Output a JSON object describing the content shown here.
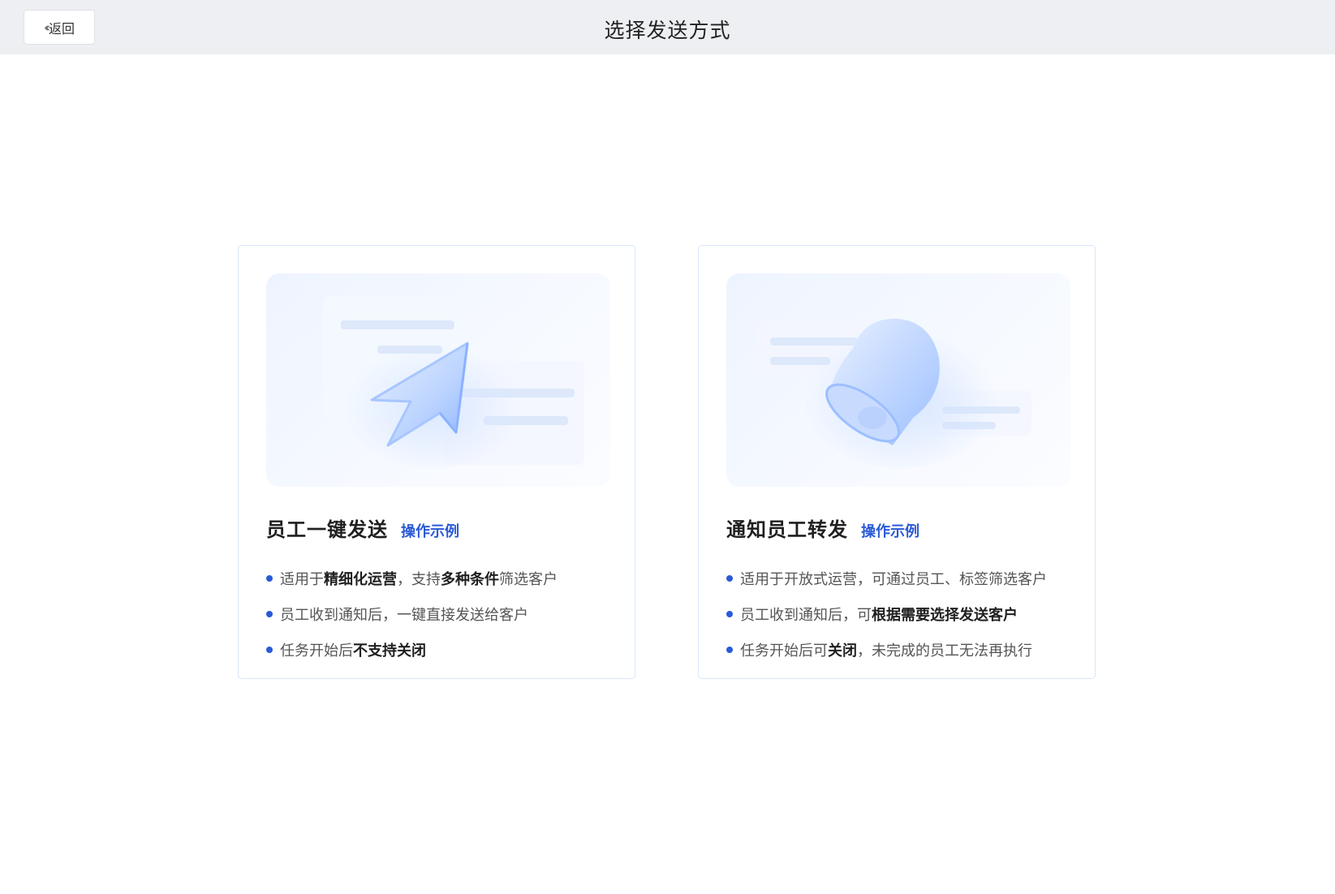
{
  "header": {
    "back_label": "返回",
    "back_icon": "double-chevron-left-icon",
    "title": "选择发送方式"
  },
  "cards": [
    {
      "illustration": "cursor-click-illustration",
      "title": "员工一键发送",
      "link": "操作示例",
      "features": [
        {
          "p1": "适用于",
          "b1": "精细化运营",
          "p2": "，支持",
          "b2": "多种条件",
          "p3": "筛选客户"
        },
        {
          "p1": "员工收到通知后，一键直接发送给客户",
          "b1": "",
          "p2": "",
          "b2": "",
          "p3": ""
        },
        {
          "p1": "任务开始后",
          "b1": "不支持关闭",
          "p2": "",
          "b2": "",
          "p3": ""
        }
      ]
    },
    {
      "illustration": "bell-illustration",
      "title": "通知员工转发",
      "link": "操作示例",
      "features": [
        {
          "p1": "适用于开放式运营，可通过员工、标签筛选客户",
          "b1": "",
          "p2": "",
          "b2": "",
          "p3": ""
        },
        {
          "p1": "员工收到通知后，可",
          "b1": "根据需要选择发送客户",
          "p2": "",
          "b2": "",
          "p3": ""
        },
        {
          "p1": "任务开始后可",
          "b1": "关闭",
          "p2": "，未完成的员工无法再执行",
          "b2": "",
          "p3": ""
        }
      ]
    }
  ],
  "colors": {
    "accent": "#2a5ad7",
    "header_bg": "#eeeff2",
    "card_border": "#d8e6fb"
  }
}
